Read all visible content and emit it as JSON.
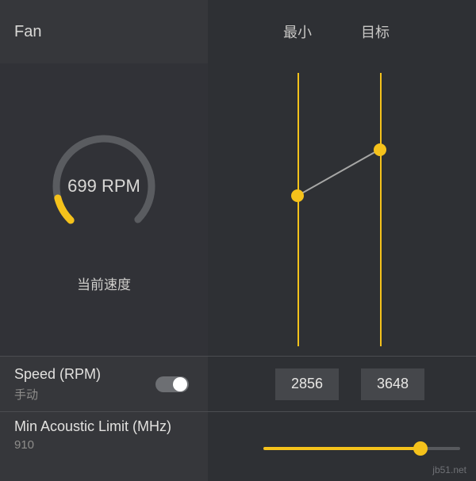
{
  "left": {
    "title": "Fan",
    "gauge_value": "699 RPM",
    "gauge_caption": "当前速度",
    "speed_row": {
      "title": "Speed (RPM)",
      "sub": "手动"
    },
    "acoustic_row": {
      "title": "Min Acoustic Limit (MHz)",
      "sub": "910"
    }
  },
  "right": {
    "header_min": "最小",
    "header_target": "目标",
    "min_value": "2856",
    "target_value": "3648",
    "sliders": {
      "min_pct": 55,
      "target_pct": 72,
      "acoustic_pct": 80
    }
  },
  "watermark": "jb51.net"
}
